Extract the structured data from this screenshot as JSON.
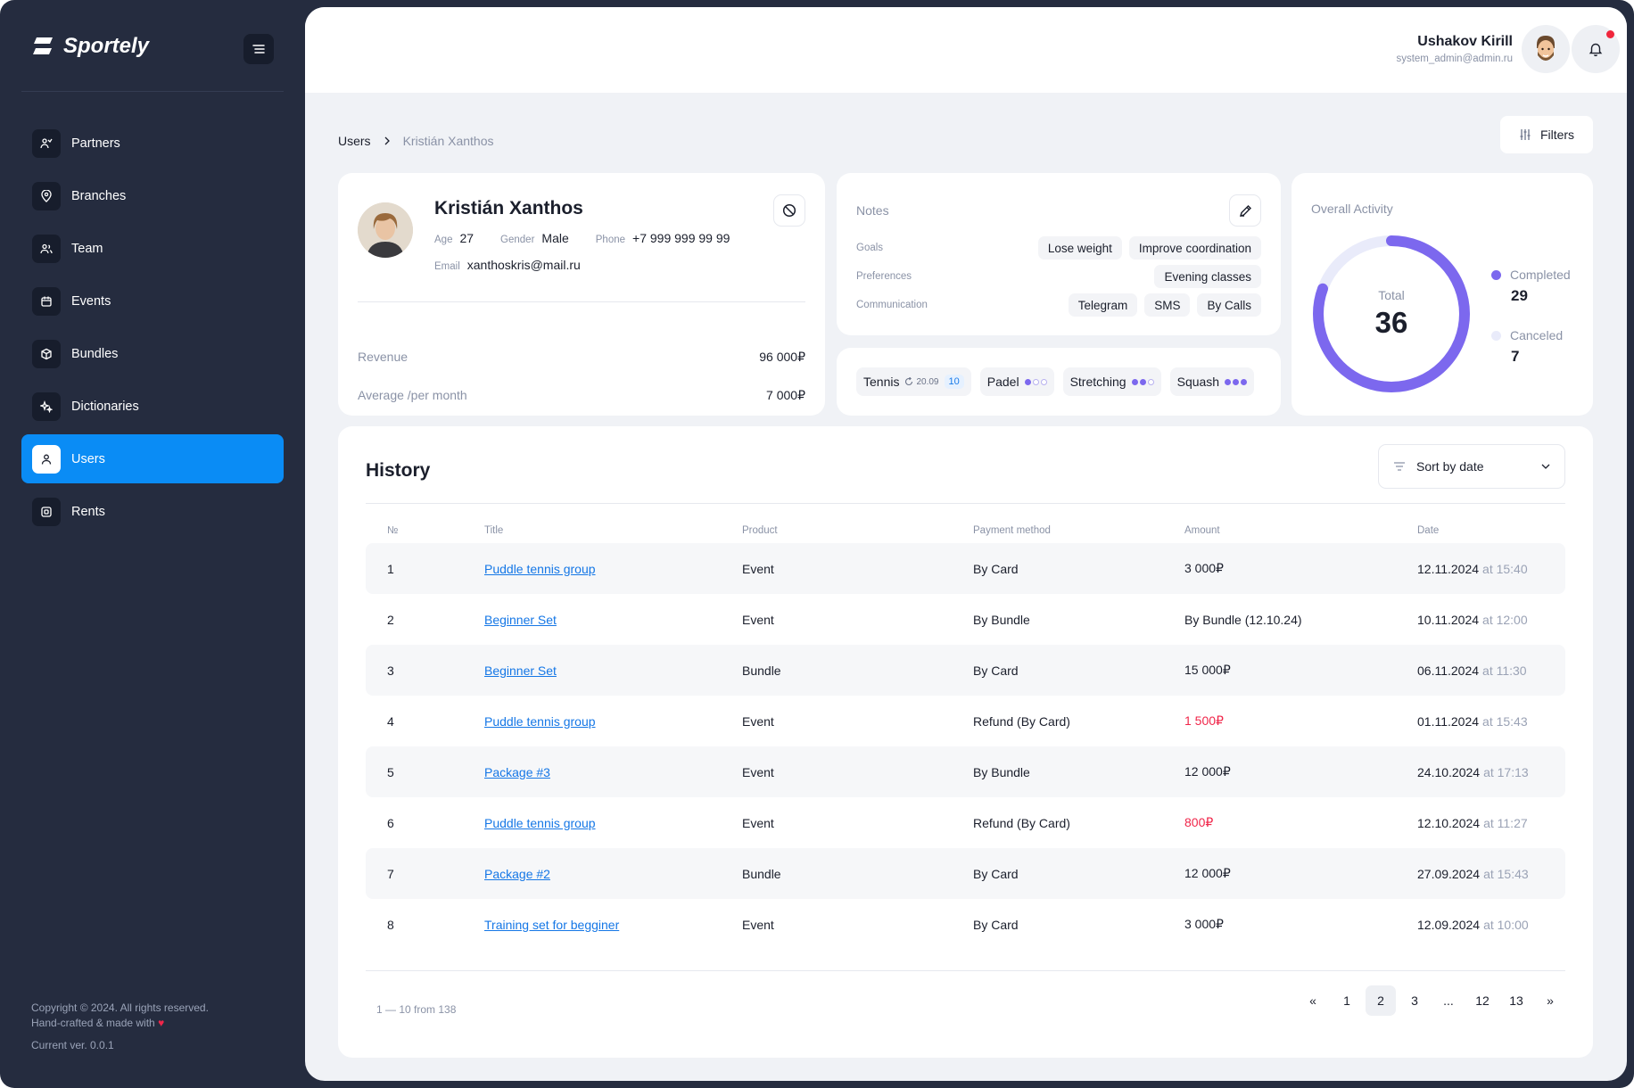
{
  "brand": {
    "name": "Sportely"
  },
  "sidebar": {
    "items": [
      {
        "label": "Partners",
        "icon": "partners-icon"
      },
      {
        "label": "Branches",
        "icon": "location-pin-icon"
      },
      {
        "label": "Team",
        "icon": "team-icon"
      },
      {
        "label": "Events",
        "icon": "calendar-icon"
      },
      {
        "label": "Bundles",
        "icon": "box-icon"
      },
      {
        "label": "Dictionaries",
        "icon": "sparkle-icon"
      },
      {
        "label": "Users",
        "icon": "user-icon",
        "active": true
      },
      {
        "label": "Rents",
        "icon": "rent-icon"
      }
    ],
    "footer": {
      "copyright": "Copyright © 2024. All rights reserved.",
      "made_with": "Hand-crafted & made with",
      "version": "Current ver. 0.0.1"
    }
  },
  "header": {
    "user_name": "Ushakov Kirill",
    "user_email": "system_admin@admin.ru",
    "has_notification": true
  },
  "breadcrumb": {
    "root": "Users",
    "current": "Kristián Xanthos"
  },
  "filters_label": "Filters",
  "profile": {
    "name": "Kristián Xanthos",
    "age_label": "Age",
    "age": "27",
    "gender_label": "Gender",
    "gender": "Male",
    "phone_label": "Phone",
    "phone": "+7 999 999 99 99",
    "email_label": "Email",
    "email": "xanthoskris@mail.ru",
    "revenue_label": "Revenue",
    "revenue": "96 000₽",
    "avg_label": "Average /per month",
    "avg": "7 000₽"
  },
  "notes": {
    "title": "Notes",
    "goals_label": "Goals",
    "goals": [
      "Lose weight",
      "Improve coordination"
    ],
    "preferences_label": "Preferences",
    "preferences": [
      "Evening classes"
    ],
    "communication_label": "Communication",
    "communication": [
      "Telegram",
      "SMS",
      "By Calls"
    ]
  },
  "sports": {
    "tennis": {
      "label": "Tennis",
      "date": "20.09",
      "count": "10"
    },
    "padel": {
      "label": "Padel",
      "level": 1,
      "max": 3
    },
    "stretching": {
      "label": "Stretching",
      "level": 2,
      "max": 3
    },
    "squash": {
      "label": "Squash",
      "level": 3,
      "max": 3
    }
  },
  "activity": {
    "title": "Overall Activity",
    "total_label": "Total",
    "total": "36",
    "completed_label": "Completed",
    "completed": "29",
    "canceled_label": "Canceled",
    "canceled": "7",
    "colors": {
      "completed": "#7c68ee",
      "canceled": "#e9ebfa"
    }
  },
  "history": {
    "title": "History",
    "sort_label": "Sort by date",
    "columns": [
      "№",
      "Title",
      "Product",
      "Payment method",
      "Amount",
      "Date"
    ],
    "rows": [
      {
        "n": "1",
        "title": "Puddle tennis group",
        "product": "Event",
        "method": "By Card",
        "amount": "3 000₽",
        "negative": false,
        "date": "12.11.2024",
        "time": "at 15:40"
      },
      {
        "n": "2",
        "title": "Beginner Set",
        "product": "Event",
        "method": "By Bundle",
        "amount": "By Bundle (12.10.24)",
        "negative": false,
        "date": "10.11.2024",
        "time": "at 12:00"
      },
      {
        "n": "3",
        "title": "Beginner Set",
        "product": "Bundle",
        "method": "By Card",
        "amount": "15 000₽",
        "negative": false,
        "date": "06.11.2024",
        "time": "at 11:30"
      },
      {
        "n": "4",
        "title": "Puddle tennis group",
        "product": "Event",
        "method": "Refund (By Card)",
        "amount": "1 500₽",
        "negative": true,
        "date": "01.11.2024",
        "time": "at 15:43"
      },
      {
        "n": "5",
        "title": "Package #3",
        "product": "Event",
        "method": "By Bundle",
        "amount": "12 000₽",
        "negative": false,
        "date": "24.10.2024",
        "time": "at 17:13"
      },
      {
        "n": "6",
        "title": "Puddle tennis group",
        "product": "Event",
        "method": "Refund (By Card)",
        "amount": "800₽",
        "negative": true,
        "date": "12.10.2024",
        "time": "at 11:27"
      },
      {
        "n": "7",
        "title": "Package #2",
        "product": "Bundle",
        "method": "By Card",
        "amount": "12 000₽",
        "negative": false,
        "date": "27.09.2024",
        "time": "at 15:43"
      },
      {
        "n": "8",
        "title": "Training set for begginer",
        "product": "Event",
        "method": "By Card",
        "amount": "3 000₽",
        "negative": false,
        "date": "12.09.2024",
        "time": "at 10:00"
      }
    ],
    "range": "1 — 10 from 138",
    "pages": [
      "«",
      "1",
      "2",
      "3",
      "...",
      "12",
      "13",
      "»"
    ],
    "current_page": "2"
  },
  "colors": {
    "accent": "#0a8cf5",
    "sidebar": "#252c3f",
    "negative": "#f0264a",
    "link": "#1577e6"
  }
}
